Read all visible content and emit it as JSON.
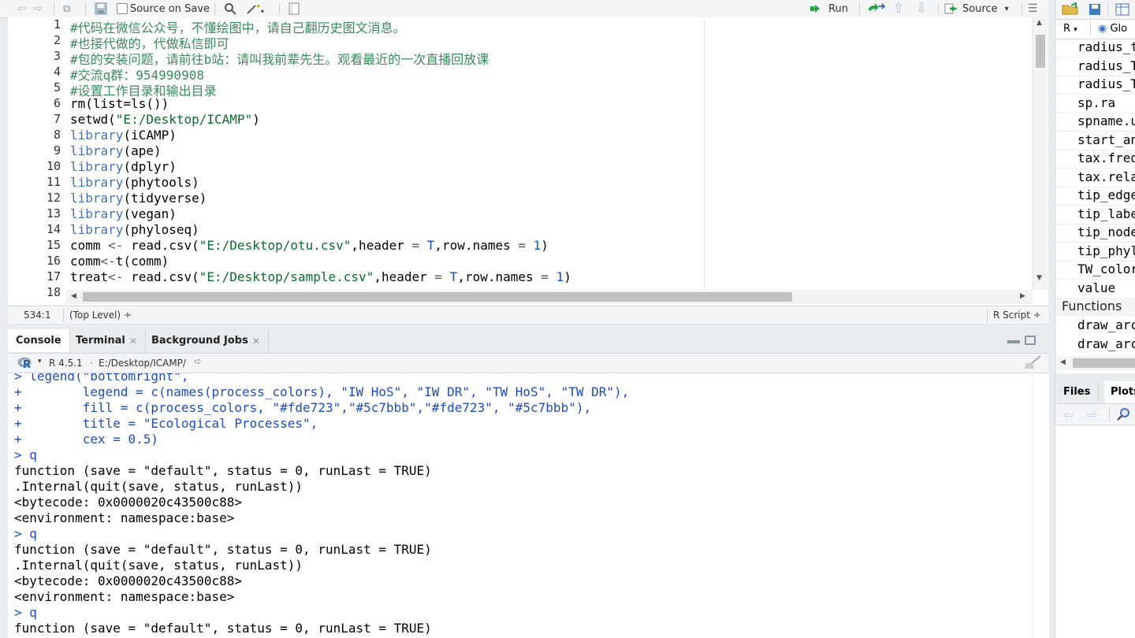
{
  "editor_toolbar": {
    "source_on_save": "Source on Save",
    "run": "Run",
    "source": "Source"
  },
  "editor_lines": [
    {
      "n": "1",
      "segs": [
        {
          "t": "#代码在微信公众号，不懂绘图中，请自己翻历史图文消息。",
          "c": "cm"
        }
      ]
    },
    {
      "n": "2",
      "segs": [
        {
          "t": "#也接代做的，代做私信即可",
          "c": "cm"
        }
      ]
    },
    {
      "n": "3",
      "segs": [
        {
          "t": "#包的安装问题，请前往b站：请叫我前辈先生。观看最近的一次直播回放课",
          "c": "cm"
        }
      ]
    },
    {
      "n": "4",
      "segs": [
        {
          "t": "#交流q群：954990908",
          "c": "cm"
        }
      ]
    },
    {
      "n": "5",
      "segs": [
        {
          "t": "#设置工作目录和输出目录",
          "c": "cm"
        }
      ]
    },
    {
      "n": "6",
      "segs": [
        {
          "t": "rm(list=ls())",
          "c": ""
        }
      ]
    },
    {
      "n": "7",
      "segs": [
        {
          "t": "setwd(",
          "c": ""
        },
        {
          "t": "\"E:/Desktop/ICAMP\"",
          "c": "st"
        },
        {
          "t": ")",
          "c": ""
        }
      ]
    },
    {
      "n": "8",
      "segs": [
        {
          "t": "library",
          "c": "fn"
        },
        {
          "t": "(iCAMP)",
          "c": ""
        }
      ]
    },
    {
      "n": "9",
      "segs": [
        {
          "t": "library",
          "c": "fn"
        },
        {
          "t": "(ape)",
          "c": ""
        }
      ]
    },
    {
      "n": "10",
      "segs": [
        {
          "t": "library",
          "c": "fn"
        },
        {
          "t": "(dplyr)",
          "c": ""
        }
      ]
    },
    {
      "n": "11",
      "segs": [
        {
          "t": "library",
          "c": "fn"
        },
        {
          "t": "(phytools)",
          "c": ""
        }
      ]
    },
    {
      "n": "12",
      "segs": [
        {
          "t": "library",
          "c": "fn"
        },
        {
          "t": "(tidyverse)",
          "c": ""
        }
      ]
    },
    {
      "n": "13",
      "segs": [
        {
          "t": "library",
          "c": "fn"
        },
        {
          "t": "(vegan)",
          "c": ""
        }
      ]
    },
    {
      "n": "14",
      "segs": [
        {
          "t": "library",
          "c": "fn"
        },
        {
          "t": "(phyloseq)",
          "c": ""
        }
      ]
    },
    {
      "n": "15",
      "segs": [
        {
          "t": "comm ",
          "c": ""
        },
        {
          "t": "<-",
          "c": "op"
        },
        {
          "t": " read.csv(",
          "c": ""
        },
        {
          "t": "\"E:/Desktop/otu.csv\"",
          "c": "st"
        },
        {
          "t": ",header ",
          "c": ""
        },
        {
          "t": "=",
          "c": "op"
        },
        {
          "t": " ",
          "c": ""
        },
        {
          "t": "T",
          "c": "nm"
        },
        {
          "t": ",row.names ",
          "c": ""
        },
        {
          "t": "=",
          "c": "op"
        },
        {
          "t": " ",
          "c": ""
        },
        {
          "t": "1",
          "c": "nm"
        },
        {
          "t": ")",
          "c": ""
        }
      ]
    },
    {
      "n": "16",
      "segs": [
        {
          "t": "comm",
          "c": ""
        },
        {
          "t": "<-",
          "c": "op"
        },
        {
          "t": "t(comm)",
          "c": ""
        }
      ]
    },
    {
      "n": "17",
      "segs": [
        {
          "t": "treat",
          "c": ""
        },
        {
          "t": "<-",
          "c": "op"
        },
        {
          "t": " read.csv(",
          "c": ""
        },
        {
          "t": "\"E:/Desktop/sample.csv\"",
          "c": "st"
        },
        {
          "t": ",header ",
          "c": ""
        },
        {
          "t": "=",
          "c": "op"
        },
        {
          "t": " ",
          "c": ""
        },
        {
          "t": "T",
          "c": "nm"
        },
        {
          "t": ",row.names ",
          "c": ""
        },
        {
          "t": "=",
          "c": "op"
        },
        {
          "t": " ",
          "c": ""
        },
        {
          "t": "1",
          "c": "nm"
        },
        {
          "t": ")",
          "c": ""
        }
      ]
    },
    {
      "n": "18",
      "segs": [
        {
          "t": "",
          "c": ""
        }
      ]
    }
  ],
  "status_bar": {
    "position": "534:1",
    "scope": "(Top Level) ÷",
    "filetype": "R Script ÷"
  },
  "console_tabs": [
    "Console",
    "Terminal",
    "Background Jobs"
  ],
  "console_path": {
    "r_version": "R 4.5.1",
    "path": "E:/Desktop/ICAMP/"
  },
  "console_lines": [
    {
      "t": "> legend(\"bottomright\",",
      "c": "cin"
    },
    {
      "t": "+        legend = c(names(process_colors), \"IW HoS\", \"IW DR\", \"TW HoS\", \"TW DR\"),",
      "c": "cin"
    },
    {
      "t": "+        fill = c(process_colors, \"#fde723\",\"#5c7bbb\",\"#fde723\", \"#5c7bbb\"),",
      "c": "cin"
    },
    {
      "t": "+        title = \"Ecological Processes\",",
      "c": "cin"
    },
    {
      "t": "+        cex = 0.5)",
      "c": "cin"
    },
    {
      "t": "> q",
      "c": "cin"
    },
    {
      "t": "function (save = \"default\", status = 0, runLast = TRUE)",
      "c": "cout"
    },
    {
      "t": ".Internal(quit(save, status, runLast))",
      "c": "cout"
    },
    {
      "t": "<bytecode: 0x0000020c43500c88>",
      "c": "cout"
    },
    {
      "t": "<environment: namespace:base>",
      "c": "cout"
    },
    {
      "t": "> q",
      "c": "cin"
    },
    {
      "t": "function (save = \"default\", status = 0, runLast = TRUE)",
      "c": "cout"
    },
    {
      "t": ".Internal(quit(save, status, runLast))",
      "c": "cout"
    },
    {
      "t": "<bytecode: 0x0000020c43500c88>",
      "c": "cout"
    },
    {
      "t": "<environment: namespace:base>",
      "c": "cout"
    },
    {
      "t": "> q",
      "c": "cin"
    },
    {
      "t": "function (save = \"default\", status = 0, runLast = TRUE)",
      "c": "cout"
    }
  ],
  "environment": {
    "r_dropdown": "R",
    "global_label": "Glo",
    "items": [
      "radius_t",
      "radius_T",
      "radius_T",
      "sp.ra",
      "spname.u",
      "start_an",
      "tax.freq",
      "tax.rela",
      "tip_edge",
      "tip_labe",
      "tip_node",
      "tip_phyl",
      "TW_color",
      "value"
    ],
    "functions_header": "Functions",
    "function_items": [
      "draw_arc",
      "draw_arc"
    ]
  },
  "files_tabs": [
    "Files",
    "Plots"
  ]
}
